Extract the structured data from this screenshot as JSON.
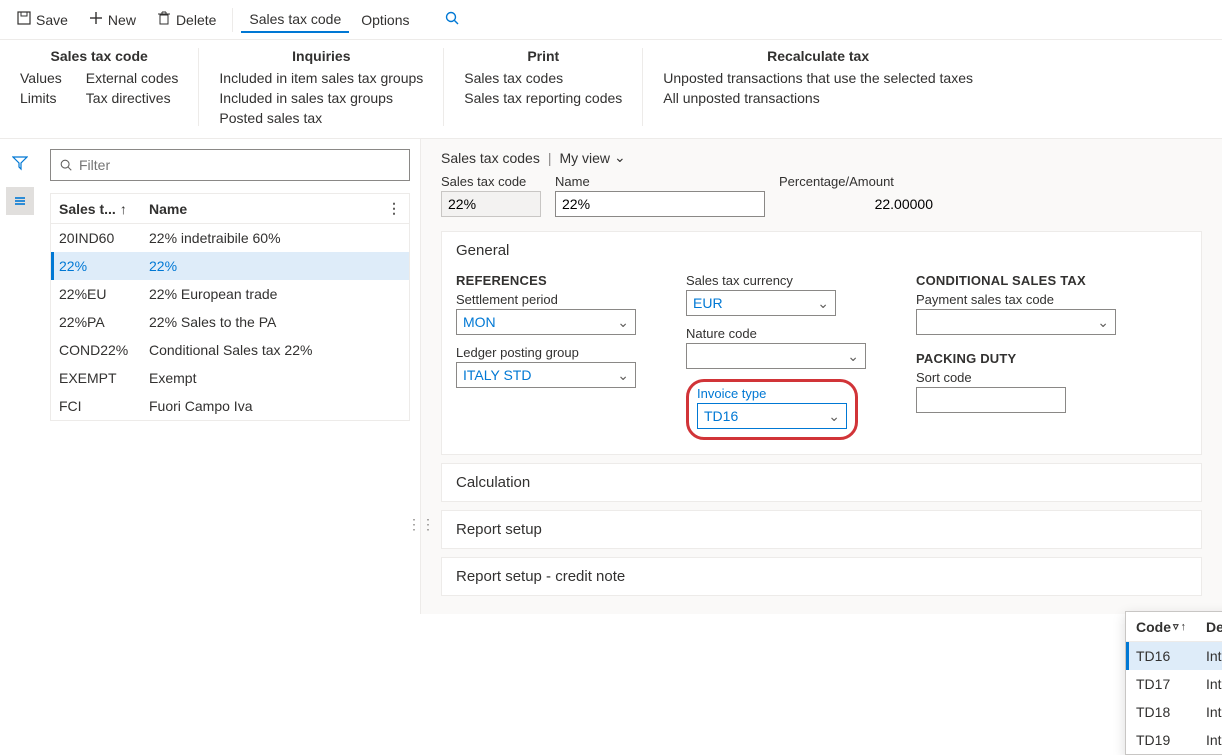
{
  "toolbar": {
    "save": "Save",
    "new": "New",
    "delete": "Delete",
    "salesTaxCode": "Sales tax code",
    "options": "Options"
  },
  "ribbon": {
    "groups": [
      {
        "title": "Sales tax code",
        "cols": [
          [
            "Values",
            "Limits"
          ],
          [
            "External codes",
            "Tax directives"
          ]
        ]
      },
      {
        "title": "Inquiries",
        "cols": [
          [
            "Included in item sales tax groups",
            "Included in sales tax groups",
            "Posted sales tax"
          ]
        ]
      },
      {
        "title": "Print",
        "cols": [
          [
            "Sales tax codes",
            "Sales tax reporting codes"
          ]
        ]
      },
      {
        "title": "Recalculate tax",
        "cols": [
          [
            "Unposted transactions that use the selected taxes",
            "All unposted transactions"
          ]
        ]
      }
    ]
  },
  "filter": {
    "placeholder": "Filter"
  },
  "grid": {
    "col1": "Sales t...",
    "col2": "Name",
    "rows": [
      {
        "code": "20IND60",
        "name": "22% indetraibile 60%"
      },
      {
        "code": "22%",
        "name": "22%",
        "selected": true
      },
      {
        "code": "22%EU",
        "name": "22% European trade"
      },
      {
        "code": "22%PA",
        "name": "22% Sales to the PA"
      },
      {
        "code": "COND22%",
        "name": "Conditional Sales tax 22%"
      },
      {
        "code": "EXEMPT",
        "name": "Exempt"
      },
      {
        "code": "FCI",
        "name": "Fuori Campo Iva"
      }
    ]
  },
  "detail": {
    "title": "Sales tax codes",
    "viewLabel": "My view",
    "fields": {
      "codeLabel": "Sales tax code",
      "codeValue": "22%",
      "nameLabel": "Name",
      "nameValue": "22%",
      "pctLabel": "Percentage/Amount",
      "pctValue": "22.00000"
    },
    "general": {
      "title": "General",
      "references": "REFERENCES",
      "settlementLabel": "Settlement period",
      "settlementValue": "MON",
      "ledgerLabel": "Ledger posting group",
      "ledgerValue": "ITALY STD",
      "currencyLabel": "Sales tax currency",
      "currencyValue": "EUR",
      "natureLabel": "Nature code",
      "natureValue": "",
      "invoiceTypeLabel": "Invoice type",
      "invoiceTypeValue": "TD16",
      "conditional": "CONDITIONAL SALES TAX",
      "paymentLabel": "Payment sales tax code",
      "packing": "PACKING DUTY",
      "sortLabel": "Sort code"
    },
    "calculation": "Calculation",
    "reportSetup": "Report setup",
    "reportCredit": "Report setup - credit note"
  },
  "dropdown": {
    "col1": "Code",
    "col2": "Description",
    "rows": [
      {
        "code": "TD16",
        "desc": "Integrazione fattura reverse charge i...",
        "sel": true
      },
      {
        "code": "TD17",
        "desc": "Integrazione/autofattura per acquist..."
      },
      {
        "code": "TD18",
        "desc": "Integrazione per acquisto di beni intr..."
      },
      {
        "code": "TD19",
        "desc": "Integrazione/autofattura per acquist..."
      }
    ]
  }
}
